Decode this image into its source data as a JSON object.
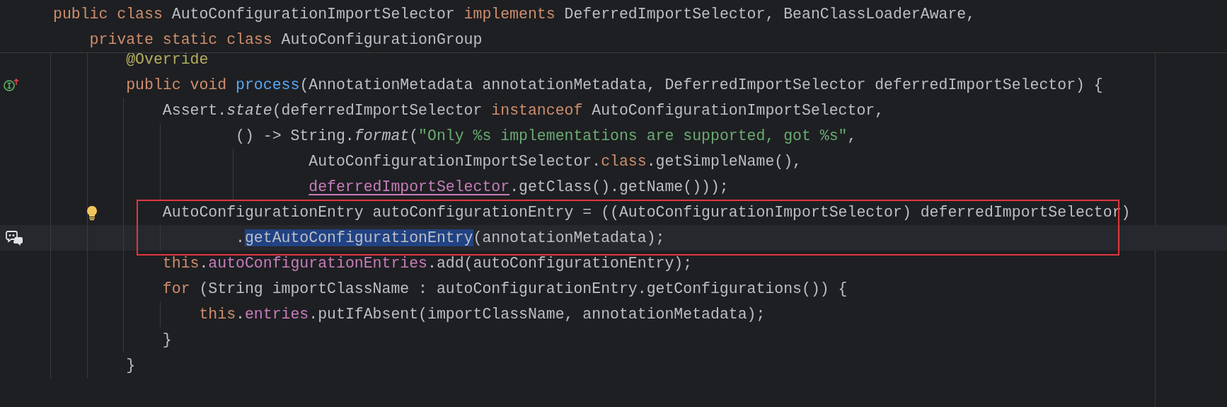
{
  "sticky_header": {
    "lines": [
      {
        "tokens": [
          {
            "kind": "keyword",
            "text": "public class "
          },
          {
            "kind": "plain",
            "text": "AutoConfigurationImportSelector "
          },
          {
            "kind": "keyword",
            "text": "implements "
          },
          {
            "kind": "plain",
            "text": "DeferredImportSelector, BeanClassLoaderAware,"
          }
        ]
      },
      {
        "tokens": [
          {
            "kind": "keyword",
            "text": "    private static class "
          },
          {
            "kind": "plain",
            "text": "AutoConfigurationGroup"
          }
        ]
      }
    ]
  },
  "editor": {
    "lines": [
      {
        "kind": "plain",
        "tokens": [
          {
            "kind": "annotation",
            "text": "        @Override"
          }
        ]
      },
      {
        "kind": "implements-marker",
        "tokens": [
          {
            "kind": "keyword",
            "text": "        public void "
          },
          {
            "kind": "method",
            "text": "process"
          },
          {
            "kind": "plain",
            "text": "(AnnotationMetadata annotationMetadata, DeferredImportSelector deferredImportSelector) {"
          }
        ]
      },
      {
        "kind": "plain",
        "tokens": [
          {
            "kind": "plain",
            "text": "            Assert."
          },
          {
            "kind": "static-call",
            "text": "state"
          },
          {
            "kind": "plain",
            "text": "(deferredImportSelector "
          },
          {
            "kind": "keyword",
            "text": "instanceof "
          },
          {
            "kind": "plain",
            "text": "AutoConfigurationImportSelector,"
          }
        ]
      },
      {
        "kind": "plain",
        "tokens": [
          {
            "kind": "plain",
            "text": "                    () -> String."
          },
          {
            "kind": "static-call",
            "text": "format"
          },
          {
            "kind": "plain",
            "text": "("
          },
          {
            "kind": "string",
            "text": "\"Only %s implementations are supported, got %s\""
          },
          {
            "kind": "plain",
            "text": ","
          }
        ]
      },
      {
        "kind": "plain",
        "tokens": [
          {
            "kind": "plain",
            "text": "                            AutoConfigurationImportSelector."
          },
          {
            "kind": "keyword",
            "text": "class"
          },
          {
            "kind": "plain",
            "text": ".getSimpleName(),"
          }
        ]
      },
      {
        "kind": "plain",
        "tokens": [
          {
            "kind": "captured",
            "text": "                            deferredImportSelector"
          },
          {
            "kind": "plain",
            "text": ".getClass().getName()));"
          }
        ]
      },
      {
        "kind": "bulb",
        "framed": true,
        "current": false,
        "tokens": [
          {
            "kind": "plain",
            "text": "            AutoConfigurationEntry autoConfigurationEntry = ((AutoConfigurationImportSelector) deferredImportSelector)"
          }
        ]
      },
      {
        "kind": "chat",
        "framed": true,
        "current": true,
        "tokens": [
          {
            "kind": "plain",
            "text": "                    ."
          },
          {
            "kind": "selected",
            "text": "getAutoConfigurationEntry"
          },
          {
            "kind": "plain",
            "text": "(annotationMetadata);"
          }
        ]
      },
      {
        "kind": "plain",
        "tokens": [
          {
            "kind": "keyword",
            "text": "            this"
          },
          {
            "kind": "plain",
            "text": "."
          },
          {
            "kind": "field",
            "text": "autoConfigurationEntries"
          },
          {
            "kind": "plain",
            "text": ".add(autoConfigurationEntry);"
          }
        ]
      },
      {
        "kind": "plain",
        "tokens": [
          {
            "kind": "keyword",
            "text": "            for "
          },
          {
            "kind": "plain",
            "text": "(String importClassName : autoConfigurationEntry.getConfigurations()) {"
          }
        ]
      },
      {
        "kind": "plain",
        "tokens": [
          {
            "kind": "keyword",
            "text": "                this"
          },
          {
            "kind": "plain",
            "text": "."
          },
          {
            "kind": "field",
            "text": "entries"
          },
          {
            "kind": "plain",
            "text": ".putIfAbsent(importClassName, annotationMetadata);"
          }
        ]
      },
      {
        "kind": "plain",
        "tokens": [
          {
            "kind": "plain",
            "text": "            }"
          }
        ]
      },
      {
        "kind": "plain",
        "tokens": [
          {
            "kind": "plain",
            "text": "        }"
          }
        ]
      }
    ]
  }
}
